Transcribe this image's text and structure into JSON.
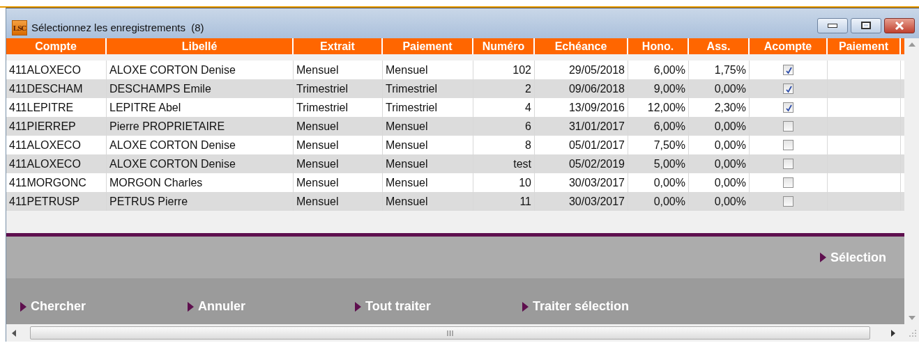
{
  "window": {
    "logo": "LSC",
    "title": "Sélectionnez les enregistrements  (8)"
  },
  "table": {
    "columns": [
      "Compte",
      "Libellé",
      "Extrait",
      "Paiement",
      "Numéro",
      "Echéance",
      "Hono.",
      "Ass.",
      "Acompte",
      "Paiement"
    ],
    "rows": [
      {
        "cells": [
          "411ALOXECO",
          "ALOXE CORTON Denise",
          "Mensuel",
          "Mensuel",
          "102",
          "29/05/2018",
          "6,00%",
          "1,75%"
        ],
        "acompte": true
      },
      {
        "cells": [
          "411DESCHAM",
          "DESCHAMPS Emile",
          "Trimestriel",
          "Trimestriel",
          "2",
          "09/06/2018",
          "9,00%",
          "0,00%"
        ],
        "acompte": true
      },
      {
        "cells": [
          "411LEPITRE",
          "LEPITRE Abel",
          "Trimestriel",
          "Trimestriel",
          "4",
          "13/09/2016",
          "12,00%",
          "2,30%"
        ],
        "acompte": true
      },
      {
        "cells": [
          "411PIERREP",
          "Pierre PROPRIETAIRE",
          "Mensuel",
          "Mensuel",
          "6",
          "31/01/2017",
          "6,00%",
          "0,00%"
        ],
        "acompte": false
      },
      {
        "cells": [
          "411ALOXECO",
          "ALOXE CORTON Denise",
          "Mensuel",
          "Mensuel",
          "8",
          "05/01/2017",
          "7,50%",
          "0,00%"
        ],
        "acompte": false
      },
      {
        "cells": [
          "411ALOXECO",
          "ALOXE CORTON Denise",
          "Mensuel",
          "Mensuel",
          "test",
          "05/02/2019",
          "5,00%",
          "0,00%"
        ],
        "acompte": false
      },
      {
        "cells": [
          "411MORGONC",
          "MORGON Charles",
          "Mensuel",
          "Mensuel",
          "10",
          "30/03/2017",
          "0,00%",
          "0,00%"
        ],
        "acompte": false
      },
      {
        "cells": [
          "411PETRUSP",
          "PETRUS Pierre",
          "Mensuel",
          "Mensuel",
          "11",
          "30/03/2017",
          "0,00%",
          "0,00%"
        ],
        "acompte": false
      }
    ]
  },
  "selection_button": "Sélection",
  "actions": [
    "Chercher",
    "Annuler",
    "Tout traiter",
    "Traiter sélection"
  ]
}
